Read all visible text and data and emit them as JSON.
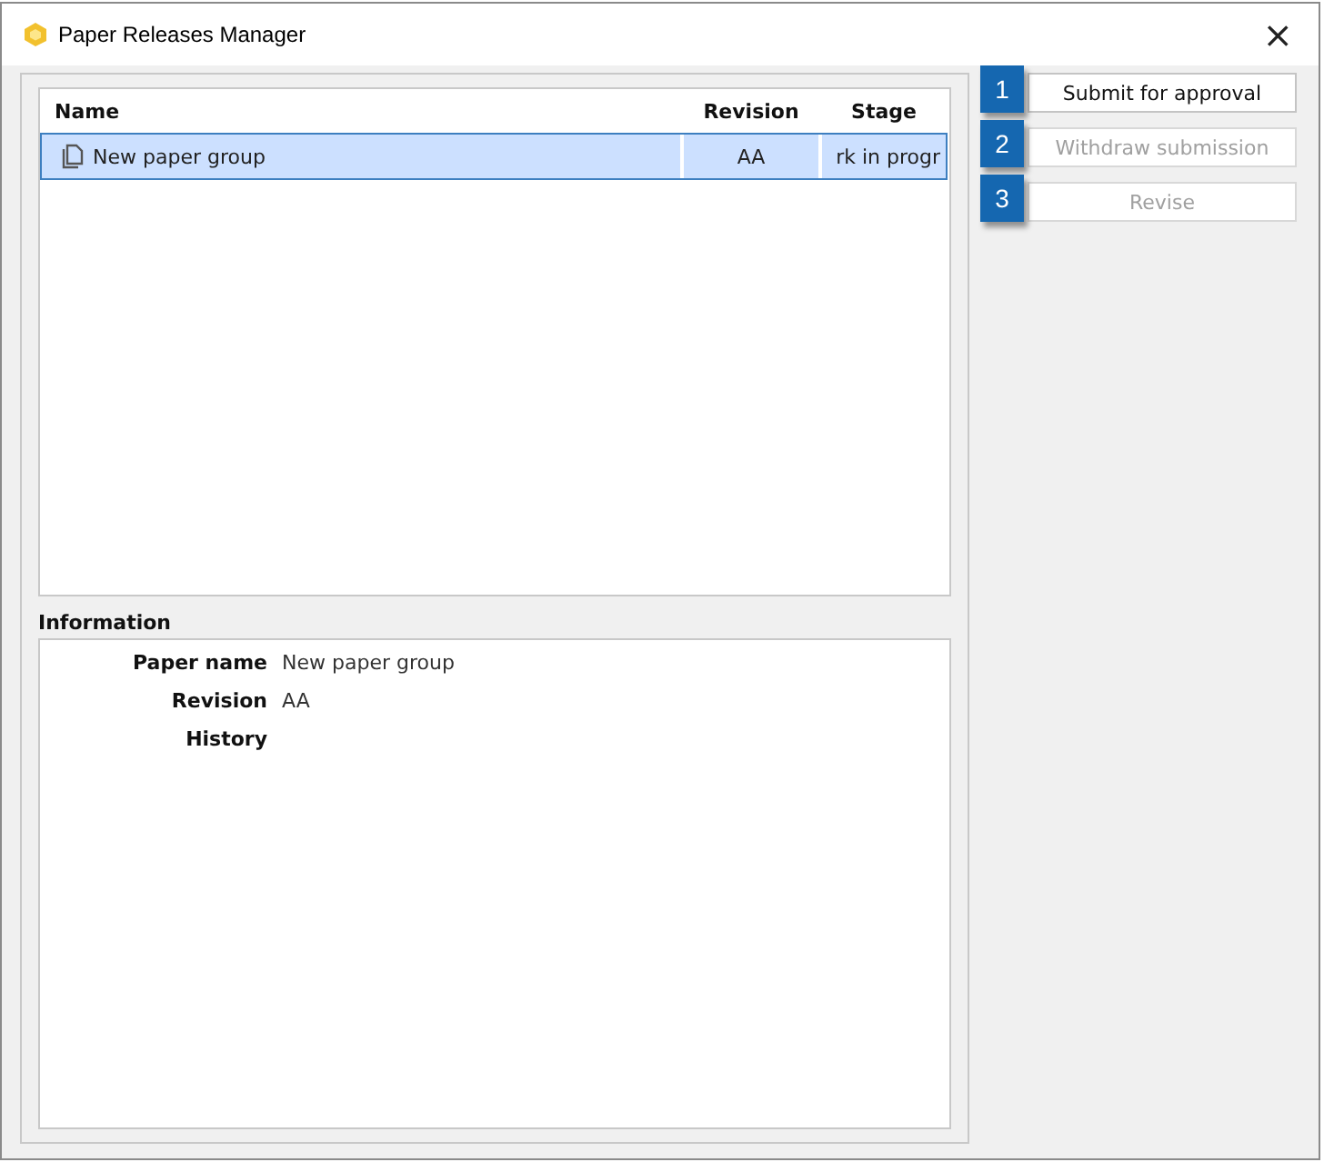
{
  "window": {
    "title": "Paper Releases Manager",
    "close": "×"
  },
  "table": {
    "columns": [
      "Name",
      "Revision",
      "Stage"
    ],
    "rows": [
      {
        "name": "New paper group",
        "revision": "AA",
        "stage": "rk in progr",
        "selected": true
      }
    ]
  },
  "information": {
    "title": "Information",
    "fields": [
      {
        "label": "Paper name",
        "value": "New paper group"
      },
      {
        "label": "Revision",
        "value": "AA"
      },
      {
        "label": "History"
      }
    ]
  },
  "buttons": [
    {
      "label": "Submit for approval",
      "callout": "1",
      "disabled": false
    },
    {
      "label": "Withdraw submission",
      "callout": "2",
      "disabled": true
    },
    {
      "label": "Revise",
      "callout": "3",
      "disabled": true
    }
  ]
}
